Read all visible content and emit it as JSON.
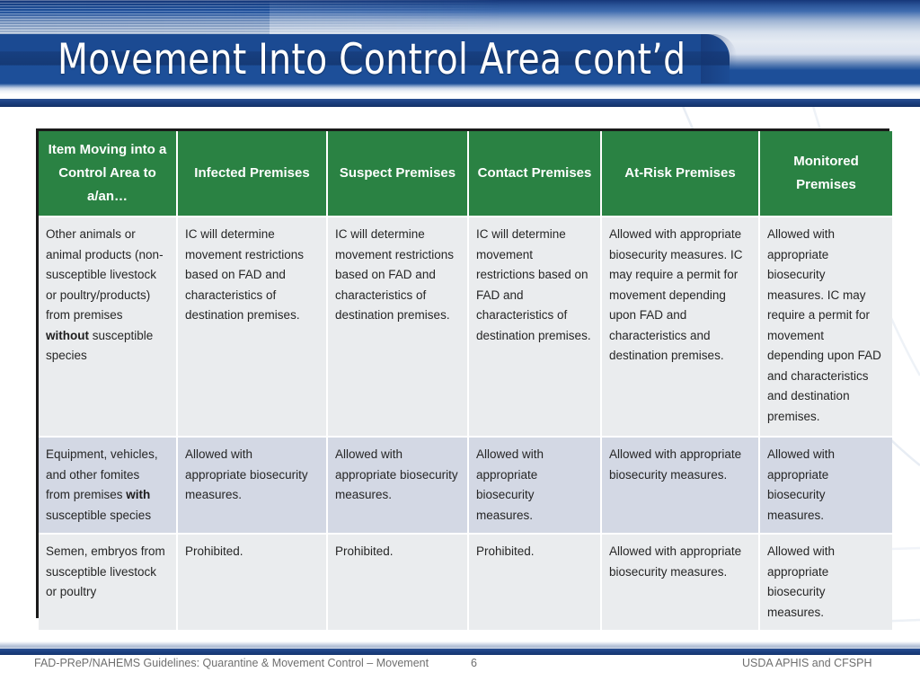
{
  "slide": {
    "title": "Movement Into Control Area cont’d"
  },
  "table": {
    "headers": [
      "Item Moving into a Control Area to a/an…",
      "Infected Premises",
      "Suspect Premises",
      "Contact Premises",
      "At-Risk Premises",
      "Monitored Premises"
    ],
    "rows": [
      {
        "item_prefix": "Other animals or animal products (non-susceptible livestock or poultry/products) from premises ",
        "item_bold": "without",
        "item_suffix": " susceptible species",
        "infected": "IC will determine movement restrictions based on FAD and characteristics of destination premises.",
        "suspect": "IC will determine movement restrictions based on FAD and characteristics of destination premises.",
        "contact": "IC will determine movement restrictions based on FAD and characteristics of destination premises.",
        "at_risk": "Allowed with appropriate biosecurity measures. IC may require a permit for movement depending upon FAD and characteristics and destination premises.",
        "monitored": "Allowed with appropriate biosecurity measures. IC may require a permit for movement depending upon FAD and characteristics and destination premises."
      },
      {
        "item_prefix": "Equipment, vehicles, and other fomites from premises ",
        "item_bold": "with",
        "item_suffix": " susceptible species",
        "infected": "Allowed with appropriate biosecurity measures.",
        "suspect": "Allowed with appropriate biosecurity measures.",
        "contact": "Allowed with appropriate biosecurity measures.",
        "at_risk": "Allowed with appropriate biosecurity measures.",
        "monitored": "Allowed with appropriate biosecurity measures."
      },
      {
        "item_prefix": "Semen, embryos from susceptible livestock or poultry",
        "item_bold": "",
        "item_suffix": "",
        "infected": "Prohibited.",
        "suspect": "Prohibited.",
        "contact": "Prohibited.",
        "at_risk": "Allowed with appropriate biosecurity measures.",
        "monitored": "Allowed with appropriate biosecurity measures."
      }
    ]
  },
  "footer": {
    "left": "FAD-PReP/NAHEMS Guidelines: Quarantine & Movement Control –  Movement",
    "page_number": "6",
    "right": "USDA APHIS and CFSPH"
  },
  "colors": {
    "header_green": "#2a8243",
    "band_navy": "#1b4a92",
    "row_light": "#eaecee",
    "row_dark": "#d3d8e4",
    "table_border": "#1a1a1a",
    "footer_text": "#6f6f6f"
  }
}
